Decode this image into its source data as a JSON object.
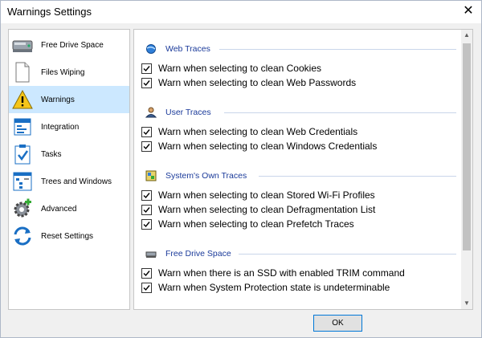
{
  "window": {
    "title": "Warnings Settings",
    "close_glyph": "✕"
  },
  "sidebar": {
    "items": [
      {
        "label": "Free Drive Space",
        "icon": "drive-icon"
      },
      {
        "label": "Files Wiping",
        "icon": "file-icon"
      },
      {
        "label": "Warnings",
        "icon": "warning-icon",
        "selected": true
      },
      {
        "label": "Integration",
        "icon": "integration-icon"
      },
      {
        "label": "Tasks",
        "icon": "tasks-icon"
      },
      {
        "label": "Trees and Windows",
        "icon": "trees-icon"
      },
      {
        "label": "Advanced",
        "icon": "gear-plus-icon"
      },
      {
        "label": "Reset Settings",
        "icon": "reset-icon"
      }
    ]
  },
  "sections": [
    {
      "title": "Web Traces",
      "icon": "web-icon",
      "items": [
        "Warn when selecting to clean Cookies",
        "Warn when selecting to clean Web Passwords"
      ]
    },
    {
      "title": "User Traces",
      "icon": "user-icon",
      "items": [
        "Warn when selecting to clean Web Credentials",
        "Warn when selecting to clean Windows Credentials"
      ]
    },
    {
      "title": "System's Own Traces",
      "icon": "system-icon",
      "items": [
        "Warn when selecting to clean Stored Wi-Fi Profiles",
        "Warn when selecting to clean Defragmentation List",
        "Warn when selecting to clean Prefetch Traces"
      ]
    },
    {
      "title": "Free Drive Space",
      "icon": "drive-small-icon",
      "items": [
        "Warn when there is an SSD with enabled TRIM command",
        "Warn when System Protection state is undeterminable"
      ]
    }
  ],
  "ok_label": "OK",
  "colors": {
    "accent": "#0078d7",
    "selected_bg": "#cce8ff",
    "section_title": "#1a3a9a"
  }
}
